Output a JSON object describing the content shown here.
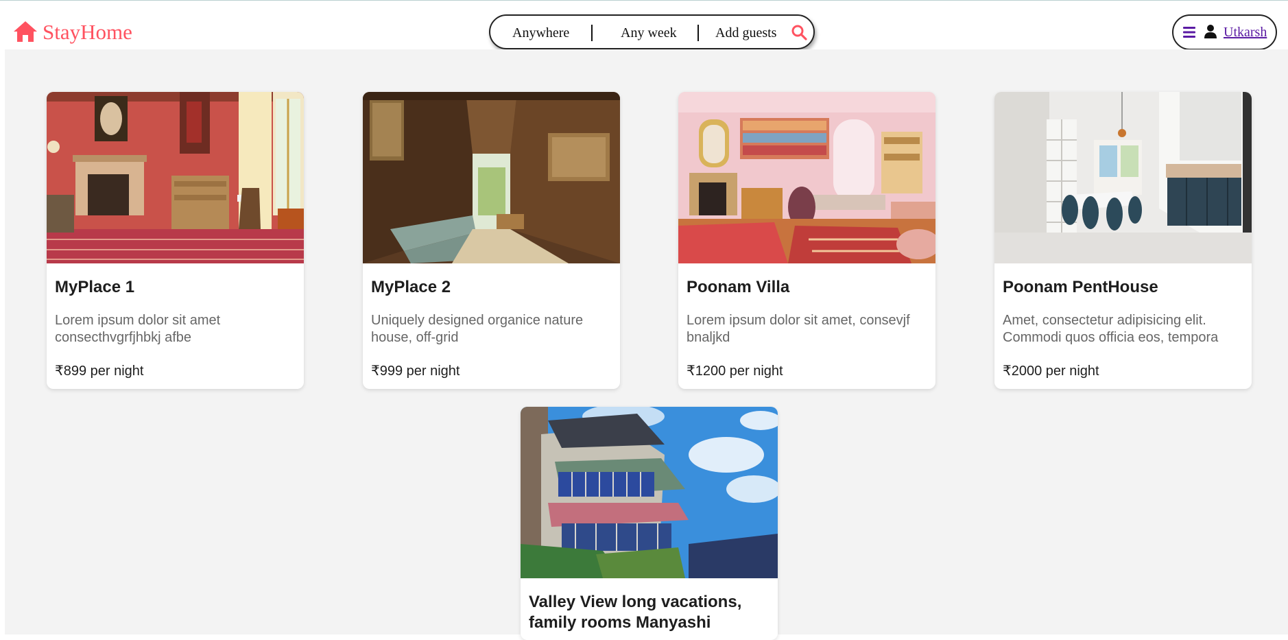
{
  "header": {
    "brand_name": "StayHome",
    "brand_color": "#ff5260",
    "search": {
      "anywhere_label": "Anywhere",
      "week_label": "Any week",
      "guests_label": "Add guests",
      "icon": "search-icon"
    },
    "user_menu": {
      "menu_icon": "hamburger-menu-icon",
      "user_icon": "user-icon",
      "username": "Utkarsh",
      "accent_color": "#5a1aa3"
    }
  },
  "listings": [
    {
      "title": "MyPlace 1",
      "description": "Lorem ipsum dolor sit amet consecthvgrfjhbkj afbe",
      "price": "₹899 per night",
      "image": "photo of a red-walled vintage living room with fireplace and patterned rug"
    },
    {
      "title": "MyPlace 2",
      "description": "Uniquely designed organice nature house, off-grid",
      "price": "₹999 per night",
      "image": "photo of a long wooden-panelled hallway with a sage green sofa"
    },
    {
      "title": "Poonam Villa",
      "description": "Lorem ipsum dolor sit amet, consevjf bnaljkd",
      "price": "₹1200 per night",
      "image": "photo of a pink living room with bookshelves and fireplace"
    },
    {
      "title": "Poonam PentHouse",
      "description": "Amet, consectetur adipisicing elit. Commodi quos officia eos, tempora",
      "price": "₹2000 per night",
      "image": "photo of a modern white kitchen with dark blue chairs"
    },
    {
      "title": "Valley View long vacations, family rooms Manyashi",
      "description": "",
      "price": "",
      "image": "photo of a multi-storey hill house under blue sky"
    }
  ]
}
